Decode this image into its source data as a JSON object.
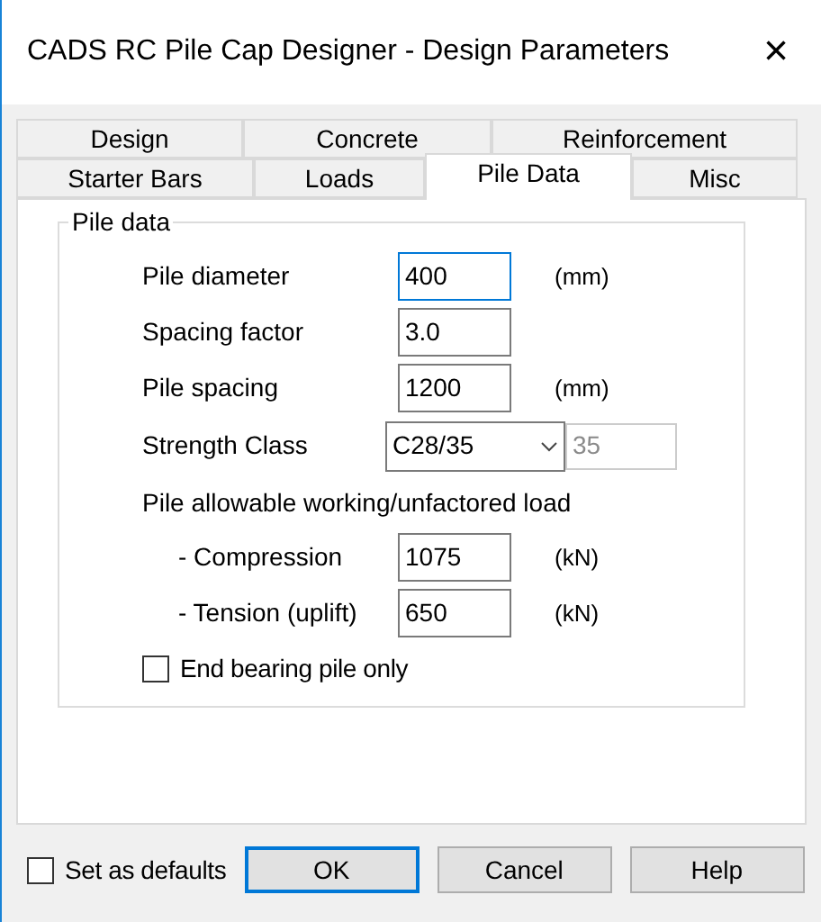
{
  "window": {
    "title": "CADS RC Pile Cap Designer - Design Parameters",
    "close": "×"
  },
  "tab_rows": [
    [
      {
        "label": "Design",
        "selected": false
      },
      {
        "label": "Concrete",
        "selected": false
      },
      {
        "label": "Reinforcement",
        "selected": false
      }
    ],
    [
      {
        "label": "Starter Bars",
        "selected": false
      },
      {
        "label": "Loads",
        "selected": false
      },
      {
        "label": "Pile Data",
        "selected": true
      },
      {
        "label": "Misc",
        "selected": false
      }
    ]
  ],
  "group": {
    "title": "Pile data",
    "rows": [
      {
        "kind": "input",
        "label": "Pile diameter",
        "value": "400",
        "unit": "(mm)",
        "focused": true
      },
      {
        "kind": "input",
        "label": "Spacing factor",
        "value": "3.0",
        "focused": false
      },
      {
        "kind": "input",
        "label": "Pile spacing",
        "value": "1200",
        "unit": "(mm)",
        "focused": false
      },
      {
        "kind": "combo",
        "label": "Strength Class",
        "value": "C28/35",
        "extra": "35"
      },
      {
        "kind": "heading",
        "label": "Pile allowable working/unfactored load"
      },
      {
        "kind": "subinput",
        "label": "- Compression",
        "value": "1075",
        "unit": "(kN)",
        "focused": false
      },
      {
        "kind": "subinput",
        "label": "- Tension (uplift)",
        "value": "650",
        "unit": "(kN)",
        "focused": false
      },
      {
        "kind": "checkbox",
        "label": "End bearing pile only",
        "checked": false
      }
    ]
  },
  "footer": {
    "set_defaults": {
      "label": "Set as defaults",
      "checked": false
    },
    "buttons": [
      {
        "label": "OK",
        "default": true
      },
      {
        "label": "Cancel",
        "default": false
      },
      {
        "label": "Help",
        "default": false
      }
    ]
  }
}
